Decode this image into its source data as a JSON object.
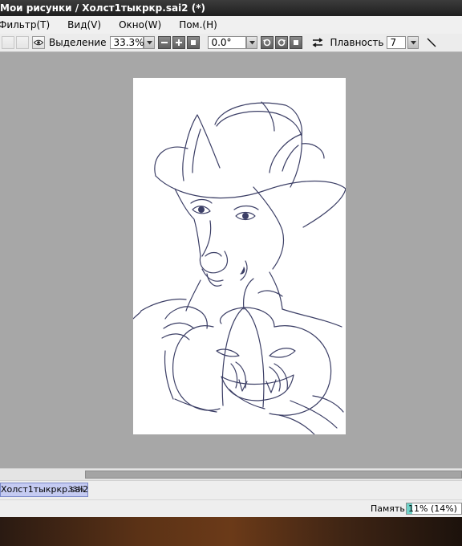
{
  "window": {
    "title": "Мои рисунки / Холст1тыкркр.sai2 (*)"
  },
  "menu": {
    "items": [
      {
        "label": "Фильтр(T)"
      },
      {
        "label": "Вид(V)"
      },
      {
        "label": "Окно(W)"
      },
      {
        "label": "Пом.(H)"
      }
    ]
  },
  "toolbar": {
    "selection_label": "Выделение",
    "zoom_value": "33.3%",
    "rotation_value": "0.0°",
    "smoothing_label": "Плавность",
    "smoothing_value": "7"
  },
  "document_tab": {
    "name": "Холст1тыкркр.sai2",
    "zoom": "33%"
  },
  "status": {
    "memory_label": "Память:",
    "memory_value": "11% (14%)",
    "memory_fraction": 0.11
  },
  "colors": {
    "canvas_background": "#a7a7a7",
    "line_art": "#3c3f66",
    "tab_active": "#c5cbf2",
    "memory_fill": "#6fd2c8"
  },
  "icons": [
    "eye-icon",
    "dropdown-arrow-icon",
    "minus-icon",
    "plus-icon",
    "reset-icon",
    "rotate-left-icon",
    "rotate-right-icon",
    "flip-icon",
    "pen-icon"
  ]
}
